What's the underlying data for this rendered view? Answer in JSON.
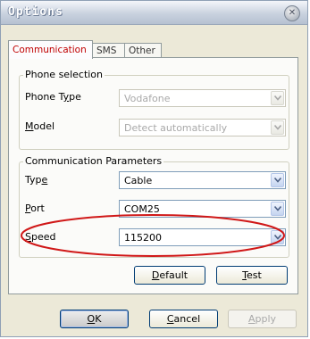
{
  "window": {
    "title": "Options",
    "close_glyph": "✕"
  },
  "tabs": [
    {
      "label": "Communication",
      "active": true
    },
    {
      "label": "SMS",
      "active": false
    },
    {
      "label": "Other",
      "active": false
    }
  ],
  "phone_selection": {
    "legend": "Phone selection",
    "phone_type": {
      "label_pre": "Phone T",
      "label_u": "y",
      "label_post": "pe",
      "value": "Vodafone",
      "enabled": false
    },
    "model": {
      "label_pre": "",
      "label_u": "M",
      "label_post": "odel",
      "value": "Detect automatically",
      "enabled": false
    }
  },
  "communication_parameters": {
    "legend": "Communication Parameters",
    "type": {
      "label_pre": "Typ",
      "label_u": "e",
      "label_post": "",
      "value": "Cable"
    },
    "port": {
      "label_pre": "",
      "label_u": "P",
      "label_post": "ort",
      "value": "COM25"
    },
    "speed": {
      "label_pre": "",
      "label_u": "S",
      "label_post": "peed",
      "value": "115200"
    }
  },
  "panel_buttons": {
    "default": {
      "pre": "",
      "u": "D",
      "post": "efault"
    },
    "test": {
      "pre": "",
      "u": "T",
      "post": "est"
    }
  },
  "dialog_buttons": {
    "ok": {
      "pre": "",
      "u": "O",
      "post": "K"
    },
    "cancel": {
      "pre": "",
      "u": "C",
      "post": "ancel"
    },
    "apply": {
      "pre": "",
      "u": "A",
      "post": "pply",
      "enabled": false
    }
  },
  "annotation": {
    "shape": "ellipse",
    "color": "#d01818"
  },
  "colors": {
    "active_tab_text": "#c00000",
    "title_text": "#ffffff",
    "disabled_text": "#a9a9a9"
  },
  "icons": {
    "close": "close-icon",
    "dropdown": "chevron-down-icon"
  }
}
